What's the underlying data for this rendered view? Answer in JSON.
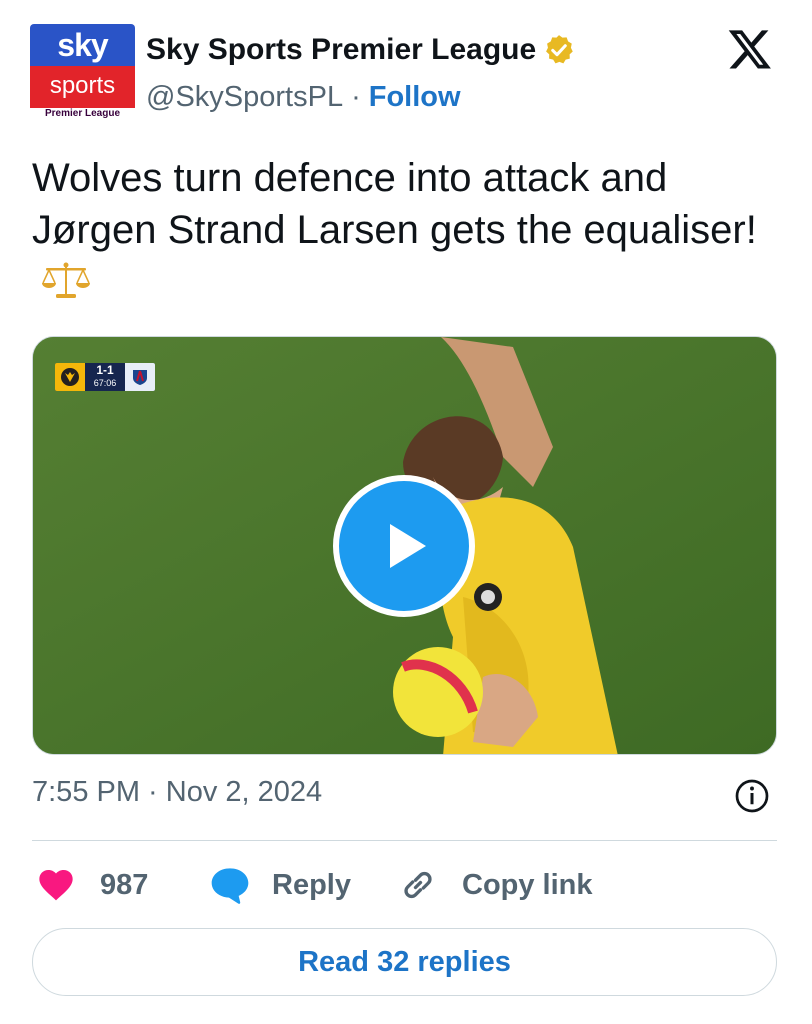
{
  "author": {
    "avatar": {
      "line1": "sky",
      "line2": "sports",
      "line3": "Premier League"
    },
    "display_name": "Sky Sports Premier League",
    "handle": "@SkySportsPL",
    "separator": "·",
    "follow_label": "Follow",
    "verified_color": "#e8b923"
  },
  "tweet": {
    "text": "Wolves turn defence into attack and Jørgen Strand Larsen gets the equaliser!",
    "emoji_icon": "balance-scale-icon"
  },
  "media": {
    "scorebug": {
      "score": "1-1",
      "clock": "67:06"
    },
    "play_icon": "play-icon",
    "accent": "#1d9bf0"
  },
  "timestamp": "7:55 PM · Nov 2, 2024",
  "actions": {
    "like_count": "987",
    "reply_label": "Reply",
    "copy_label": "Copy link",
    "like_color": "#f91880",
    "reply_color": "#1d9bf0"
  },
  "read_replies_label": "Read 32 replies"
}
